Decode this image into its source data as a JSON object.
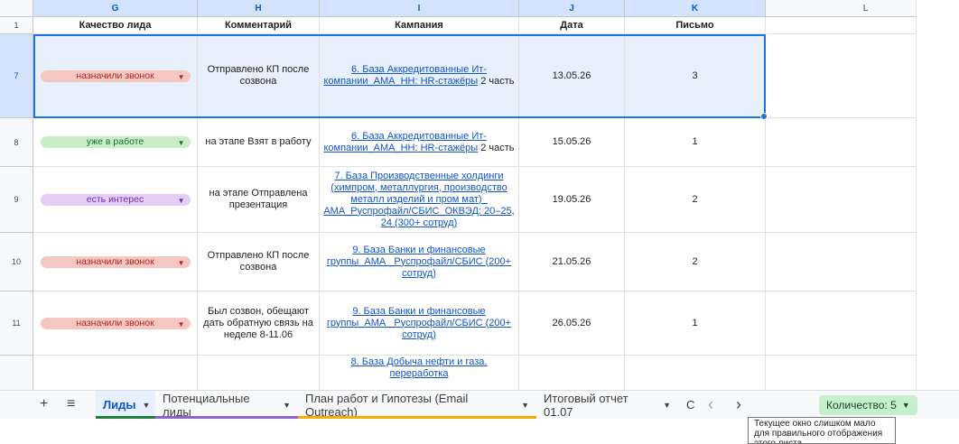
{
  "columns": [
    {
      "letter": "G",
      "selected": true
    },
    {
      "letter": "H",
      "selected": true
    },
    {
      "letter": "I",
      "selected": true
    },
    {
      "letter": "J",
      "selected": true
    },
    {
      "letter": "K",
      "selected": true
    },
    {
      "letter": "L",
      "selected": false
    }
  ],
  "header_row": {
    "row_number": "1",
    "g": "Качество лида",
    "h": "Комментарий",
    "i": "Кампания",
    "j": "Дата",
    "k": "Письмо"
  },
  "rows": [
    {
      "row_number": "7",
      "status": "назначили звонок",
      "status_color": "#f4c7c3",
      "comment": "Отправлено КП после созвона",
      "campaign_link": "6. База Аккредитованные Ит-компании_АМА_НН: HR-стажёры",
      "campaign_suffix": " 2 часть",
      "date": "13.05.26",
      "letter": "3"
    },
    {
      "row_number": "8",
      "status": "уже в работе",
      "status_color": "#c9edc4",
      "comment": "на этапе Взят в работу",
      "campaign_link": "6. База Аккредитованные Ит-компании_АМА_НН: HR-стажёры",
      "campaign_suffix": " 2 часть",
      "date": "15.05.26",
      "letter": "1"
    },
    {
      "row_number": "9",
      "status": "есть интерес",
      "status_color": "#e4cdf7",
      "comment": "на этапе Отправлена презентация",
      "campaign_link": "7. База Производственные холдинги (химпром, металлургия, производство металл изделий и пром мат)_ АМА_Руспрофайл/СБИС_ОКВЭД: 20–25, 24 (300+ сотруд)",
      "campaign_suffix": "",
      "date": "19.05.26",
      "letter": "2"
    },
    {
      "row_number": "10",
      "status": "назначили звонок",
      "status_color": "#f4c7c3",
      "comment": "Отправлено КП после созвона",
      "campaign_link": "9. База Банки и финансовые группы_АМА _Руспрофайл/СБИС (200+ сотруд)",
      "campaign_suffix": "",
      "date": "21.05.26",
      "letter": "2"
    },
    {
      "row_number": "11",
      "status": "назначили звонок",
      "status_color": "#f4c7c3",
      "comment": "Был созвон, обещают дать обратную связь на неделе 8-11.06",
      "campaign_link": "9. База Банки и финансовые группы_АМА _Руспрофайл/СБИС (200+ сотруд)",
      "campaign_suffix": "",
      "date": "26.05.26",
      "letter": "1"
    },
    {
      "row_number": "",
      "status": "",
      "status_color": "",
      "comment": "",
      "campaign_link": "8. База Добыча нефти и газа, переработка",
      "campaign_suffix": "",
      "date": "",
      "letter": ""
    }
  ],
  "tabs": {
    "add_icon": "plus-icon",
    "menu_icon": "menu-icon",
    "items": [
      {
        "label": "Лиды",
        "active": true,
        "underline": "#188038"
      },
      {
        "label": "Потенциальные лиды",
        "active": false,
        "underline": "#8e63ce"
      },
      {
        "label": "План работ и Гипотезы (Email Outreach)",
        "active": false,
        "underline": "#f9ab00"
      },
      {
        "label": "Итоговый отчет 01.07",
        "active": false,
        "underline": ""
      },
      {
        "label": "С",
        "active": false,
        "underline": ""
      }
    ],
    "prev_icon": "‹",
    "next_icon": "›",
    "count_label": "Количество: 5"
  },
  "tooltip": "Текущее окно слишком мало для правильного отображения этого листа"
}
